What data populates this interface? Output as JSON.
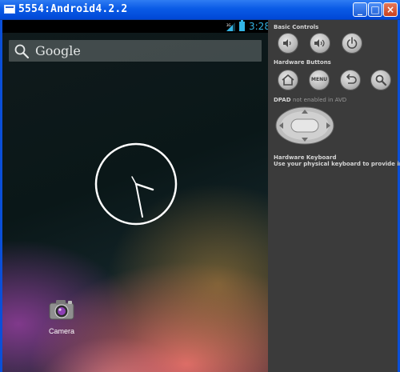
{
  "window": {
    "title": "5554:Android4.2.2",
    "minimize_label": "_",
    "maximize_label": "□",
    "close_label": "×"
  },
  "status_bar": {
    "time": "3:28",
    "signal_icon": "signal-3g-icon",
    "battery_icon": "battery-icon",
    "accent_color": "#33b5e5"
  },
  "search_bar": {
    "label": "Google",
    "icon": "search-icon"
  },
  "home_screen": {
    "apps": [
      {
        "label": "Camera",
        "icon": "camera-icon"
      }
    ]
  },
  "controls": {
    "basic_controls": {
      "title": "Basic Controls",
      "buttons": [
        "volume-down-icon",
        "volume-up-icon",
        "power-icon"
      ]
    },
    "hardware_buttons": {
      "title": "Hardware Buttons",
      "buttons": [
        "home-icon",
        "menu-button",
        "back-icon",
        "search-icon"
      ],
      "menu_label": "MENU"
    },
    "dpad": {
      "title": "DPAD",
      "note": "not enabled in AVD"
    },
    "hardware_keyboard": {
      "title": "Hardware Keyboard",
      "description": "Use your physical keyboard to provide input"
    }
  }
}
